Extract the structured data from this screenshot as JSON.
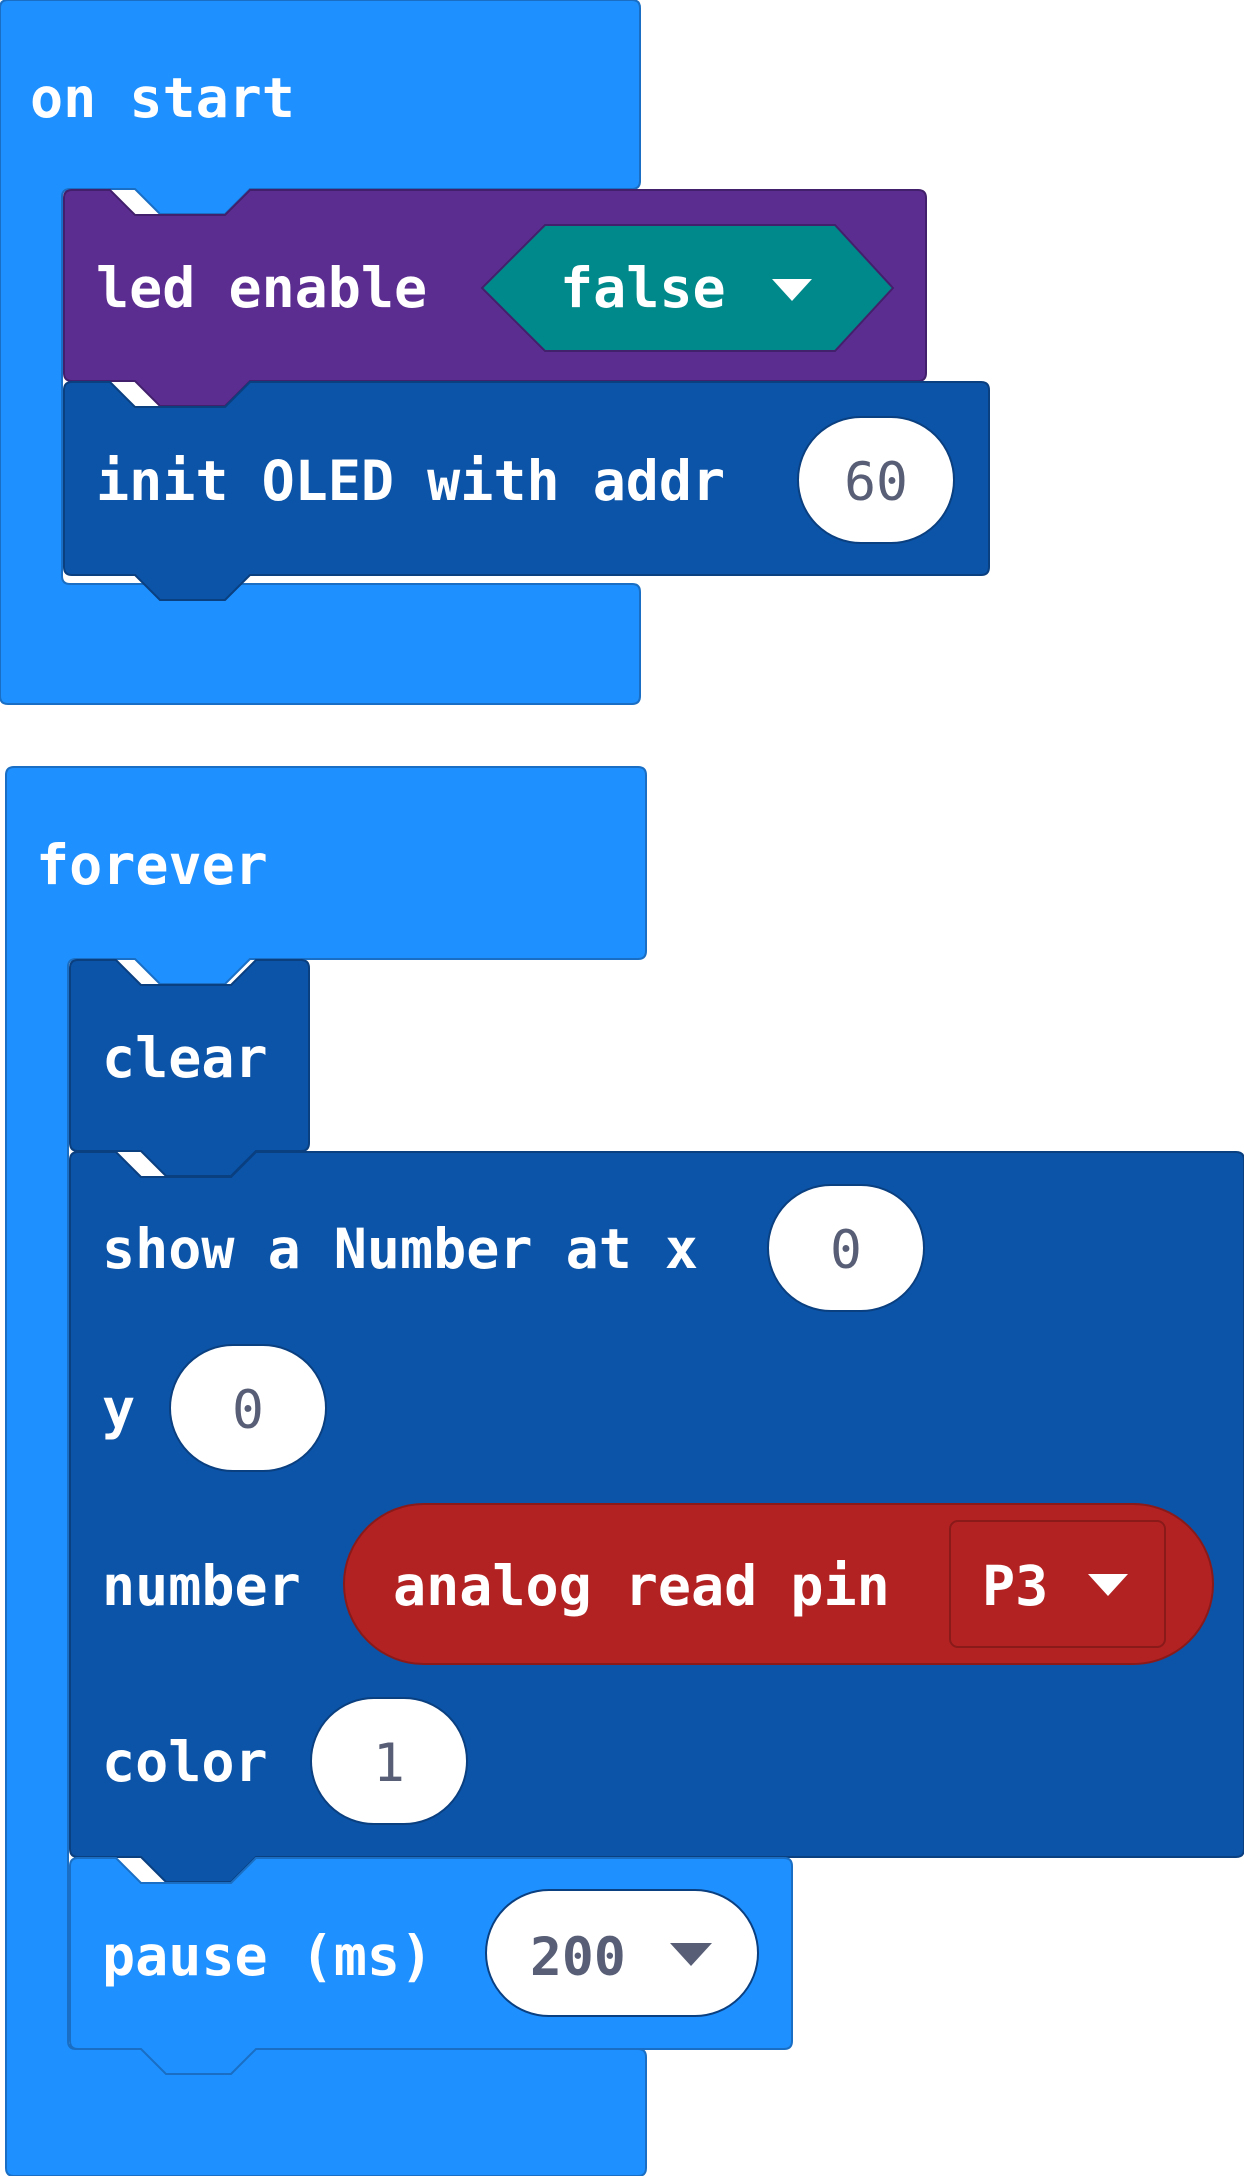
{
  "colors": {
    "events": "#1e90ff",
    "events_border": "#1a6fc4",
    "oled": "#0b54a8",
    "oled_border": "#0a3f80",
    "led": "#5c2d91",
    "led_border": "#43206c",
    "logic": "#00898a",
    "logic_border": "#006566",
    "pins": "#b32222",
    "pins_border": "#8a1a1a",
    "value_text": "#575e75"
  },
  "on_start": {
    "hat_label": "on start",
    "led_enable": {
      "label": "led enable",
      "value": "false",
      "dropdown_icon": "triangle-down-icon"
    },
    "init_oled": {
      "label": "init OLED with addr",
      "value": "60"
    }
  },
  "forever": {
    "hat_label": "forever",
    "clear": {
      "label": "clear"
    },
    "show_number": {
      "label_x": "show a Number at x",
      "x_value": "0",
      "label_y": "y",
      "y_value": "0",
      "label_number": "number",
      "analog_read": {
        "label": "analog read pin",
        "pin": "P3",
        "dropdown_icon": "triangle-down-icon"
      },
      "label_color": "color",
      "color_value": "1"
    },
    "pause": {
      "label": "pause (ms)",
      "value": "200",
      "dropdown_icon": "triangle-down-icon"
    }
  }
}
